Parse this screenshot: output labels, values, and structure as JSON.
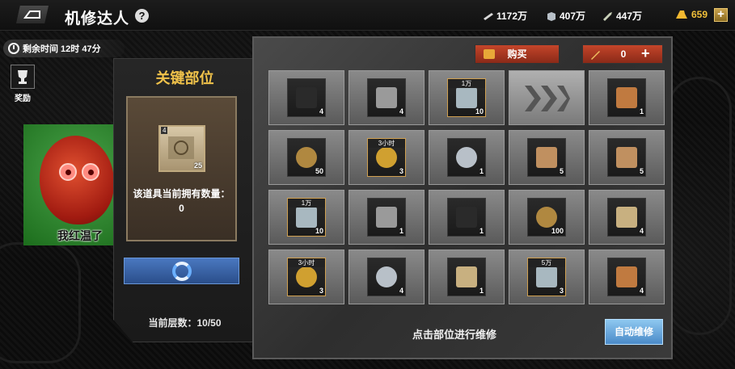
{
  "header": {
    "title": "机修达人",
    "help_icon": "?",
    "resources": [
      {
        "icon": "paper-icon",
        "value": "1172万"
      },
      {
        "icon": "box-icon",
        "value": "407万"
      },
      {
        "icon": "bullet-icon",
        "value": "447万"
      }
    ],
    "gold": {
      "icon": "gold-bar-icon",
      "value": "659",
      "add": "+"
    }
  },
  "timer": {
    "label": "剩余时间 12时 47分"
  },
  "reward": {
    "label": "奖励"
  },
  "avatar": {
    "caption": "我红温了"
  },
  "left_panel": {
    "title": "关键部位",
    "item": {
      "level": "4",
      "count": "25"
    },
    "desc": "该道具当前拥有数量：0",
    "floor": "当前层数：10/50"
  },
  "toolbar": {
    "buy_label": "购买",
    "count_value": "0",
    "count_plus": "+"
  },
  "grid": [
    {
      "icon": "rubber-part-icon",
      "tag": "",
      "count": "4"
    },
    {
      "icon": "transistor-icon",
      "tag": "",
      "count": "4"
    },
    {
      "icon": "manual-book-icon",
      "tag": "1万",
      "count": "10"
    },
    {
      "icon": "game-logo-icon",
      "tag": "",
      "count": ""
    },
    {
      "icon": "copper-pipe-icon",
      "tag": "",
      "count": "1"
    },
    {
      "icon": "gear-icon",
      "tag": "",
      "count": "50"
    },
    {
      "icon": "gold-gear-icon",
      "tag": "3小时",
      "count": "3"
    },
    {
      "icon": "metal-hub-icon",
      "tag": "",
      "count": "1"
    },
    {
      "icon": "wooden-crate-icon",
      "tag": "",
      "count": "5"
    },
    {
      "icon": "wooden-crate-icon",
      "tag": "",
      "count": "5"
    },
    {
      "icon": "manual-book-icon",
      "tag": "1万",
      "count": "10"
    },
    {
      "icon": "transistor-icon",
      "tag": "",
      "count": "1"
    },
    {
      "icon": "rubber-part-icon",
      "tag": "",
      "count": "1"
    },
    {
      "icon": "gear-icon",
      "tag": "",
      "count": "100"
    },
    {
      "icon": "battery-pack-icon",
      "tag": "",
      "count": "4"
    },
    {
      "icon": "gold-gear-icon",
      "tag": "3小时",
      "count": "3"
    },
    {
      "icon": "metal-hub-icon",
      "tag": "",
      "count": "4"
    },
    {
      "icon": "battery-pack-icon",
      "tag": "",
      "count": "1"
    },
    {
      "icon": "manual-book-icon",
      "tag": "5万",
      "count": "3"
    },
    {
      "icon": "copper-pipe-icon",
      "tag": "",
      "count": "4"
    }
  ],
  "footer": {
    "hint": "点击部位进行维修",
    "auto_button": "自动维修"
  }
}
